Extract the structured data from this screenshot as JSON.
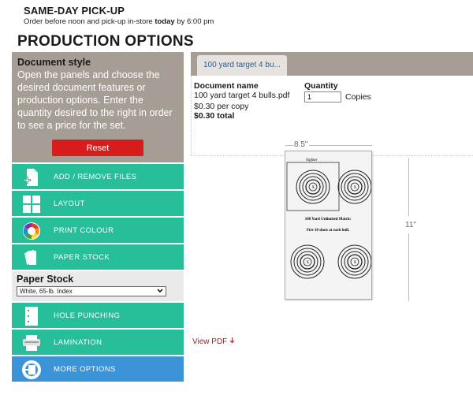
{
  "banner": {
    "title": "SAME-DAY PICK-UP",
    "sub_prefix": "Order before noon and pick-up in-store ",
    "sub_bold": "today",
    "sub_suffix": " by 6:00 pm"
  },
  "section_title": "PRODUCTION OPTIONS",
  "doc_style": {
    "title": "Document style",
    "text": "Open the panels and choose the desired document features or production options. Enter the quantity desired to the right in order to see a price for the set.",
    "reset_label": "Reset"
  },
  "options_top": [
    {
      "label": "ADD / REMOVE FILES",
      "icon": "add-file-icon"
    },
    {
      "label": "LAYOUT",
      "icon": "layout-grid-icon"
    },
    {
      "label": "PRINT COLOUR",
      "icon": "color-wheel-icon"
    },
    {
      "label": "PAPER STOCK",
      "icon": "paper-stack-icon"
    }
  ],
  "paper_stock": {
    "title": "Paper Stock",
    "selected": "White, 65-lb. Index"
  },
  "options_bottom": [
    {
      "label": "HOLE PUNCHING",
      "icon": "hole-punch-icon"
    },
    {
      "label": "LAMINATION",
      "icon": "lamination-icon"
    },
    {
      "label": "MORE OPTIONS",
      "icon": "more-options-icon"
    }
  ],
  "doc_tab": "100 yard target 4 bu...",
  "document": {
    "name_label": "Document name",
    "name": "100 yard target 4 bulls.pdf",
    "price_per_copy": "$0.30 per copy",
    "total": "$0.30 total",
    "quantity_label": "Quantity",
    "quantity": "1",
    "copies_label": "Copies"
  },
  "preview": {
    "width_label": "8.5\"",
    "height_label": "11\"",
    "page_sighter": "Sighter",
    "page_match": "100 Yard Unlimited Match:",
    "page_instr": "Fire 10 shots at each bull.",
    "bull_mark": "X"
  },
  "view_pdf": "View PDF",
  "colors": {
    "green": "#26bf9a",
    "blue": "#3b93d8",
    "taupe": "#a69d94",
    "red": "#d81b1b"
  }
}
